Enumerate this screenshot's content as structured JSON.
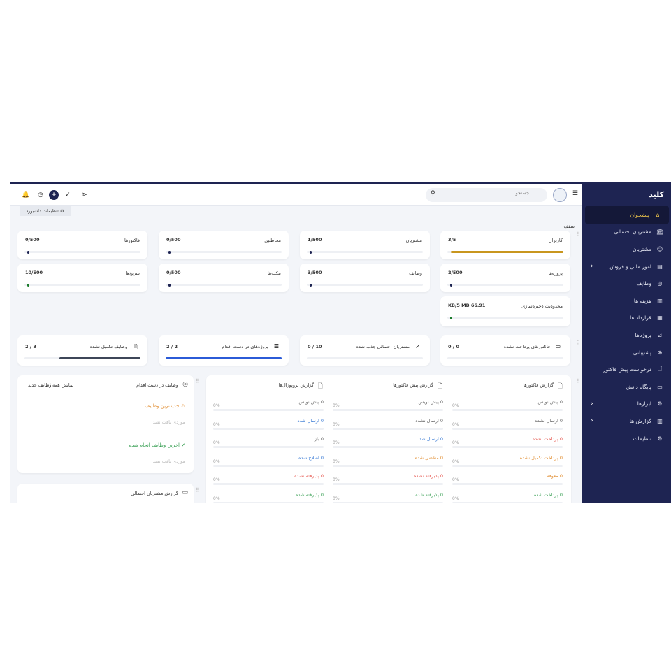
{
  "brand": "کلید",
  "sidebar": {
    "items": [
      {
        "label": "پیشخوان",
        "icon": "home-icon"
      },
      {
        "label": "مشتریان احتمالی",
        "icon": "bank-icon"
      },
      {
        "label": "مشتریان",
        "icon": "user-icon"
      },
      {
        "label": "امور مالی و فروش",
        "icon": "document-icon"
      },
      {
        "label": "وظایف",
        "icon": "check-circle-icon"
      },
      {
        "label": "هزینه ها",
        "icon": "receipt-icon"
      },
      {
        "label": "قرارداد ها",
        "icon": "contract-icon"
      },
      {
        "label": "پروژه‌ها",
        "icon": "chart-icon"
      },
      {
        "label": "پشتیبانی",
        "icon": "support-icon"
      },
      {
        "label": "درخواست پیش فاکتور",
        "icon": "file-icon"
      },
      {
        "label": "پایگاه دانش",
        "icon": "folder-icon"
      },
      {
        "label": "ابزارها",
        "icon": "tools-icon"
      },
      {
        "label": "گزارش ها",
        "icon": "report-icon"
      },
      {
        "label": "تنظیمات",
        "icon": "gear-icon"
      }
    ]
  },
  "topbar": {
    "search_placeholder": "جستجو..."
  },
  "dashboard_settings": "تنظیمات داشبورد",
  "quota_label": "سقف",
  "quota_cards": [
    {
      "title": "کاربران",
      "value": "3/5",
      "color": "#c8961e"
    },
    {
      "title": "مشتریان",
      "value": "1/500",
      "color": "#1e2452"
    },
    {
      "title": "مخاطبین",
      "value": "0/500",
      "color": "#1e2452"
    },
    {
      "title": "فاکتورها",
      "value": "0/500",
      "color": "#1e2452"
    },
    {
      "title": "پروژه‌ها",
      "value": "2/500",
      "color": "#1e2452"
    },
    {
      "title": "وظایف",
      "value": "3/500",
      "color": "#1e2452"
    },
    {
      "title": "تیکت‌ها",
      "value": "0/500",
      "color": "#1e2452"
    },
    {
      "title": "سرنخ‌ها",
      "value": "10/500",
      "color": "#1a7a2a"
    },
    {
      "title": "محدودیت ذخیره‌سازی",
      "value": "66.91 KB/5 MB",
      "color": "#1a7a2a"
    }
  ],
  "big_cards": [
    {
      "title": "فاکتورهای پرداخت نشده",
      "value": "0 / 0",
      "color": "#1e2452"
    },
    {
      "title": "مشتریان احتمالی جذب شده",
      "value": "10 / 0",
      "color": "#1e2452"
    },
    {
      "title": "پروژه‌های در دست اقدام",
      "value": "2 / 2",
      "color": "#2b5bd7"
    },
    {
      "title": "وظایف تکمیل نشده",
      "value": "3 / 2",
      "color": "#3d4658"
    }
  ],
  "reports": {
    "invoices": {
      "title": "گزارش فاکتورها",
      "rows": [
        {
          "label": "0 پیش نویس",
          "pct": "0%",
          "cls": "gray"
        },
        {
          "label": "0 ارسال نشده",
          "pct": "0%",
          "cls": "gray"
        },
        {
          "label": "0 پرداخت نشده",
          "pct": "0%",
          "cls": "red"
        },
        {
          "label": "0 پرداخت تکمیل نشده",
          "pct": "0%",
          "cls": "orange"
        },
        {
          "label": "0 معوقه",
          "pct": "0%",
          "cls": "orange"
        },
        {
          "label": "0 پرداخت شده",
          "pct": "0%",
          "cls": "green"
        }
      ]
    },
    "estimates": {
      "title": "گزارش پیش فاکتورها",
      "rows": [
        {
          "label": "0 پیش نویس",
          "pct": "0%",
          "cls": "gray"
        },
        {
          "label": "0 ارسال نشده",
          "pct": "0%",
          "cls": "gray"
        },
        {
          "label": "0 ارسال شد",
          "pct": "0%",
          "cls": "blue"
        },
        {
          "label": "0 منقضی شده",
          "pct": "0%",
          "cls": "orange"
        },
        {
          "label": "0 پذیرفته نشده",
          "pct": "0%",
          "cls": "red"
        },
        {
          "label": "0 پذیرفته شده",
          "pct": "0%",
          "cls": "green"
        }
      ]
    },
    "proposals": {
      "title": "گزارش پروپوزال‌ها",
      "rows": [
        {
          "label": "0 پیش نویس",
          "pct": "0%",
          "cls": "gray"
        },
        {
          "label": "0 ارسال شده",
          "pct": "0%",
          "cls": "blue"
        },
        {
          "label": "0 باز",
          "pct": "0%",
          "cls": "gray"
        },
        {
          "label": "0 اصلاح شده",
          "pct": "0%",
          "cls": "blue"
        },
        {
          "label": "0 پذیرفته نشده",
          "pct": "0%",
          "cls": "red"
        },
        {
          "label": "0 پذیرفته شده",
          "pct": "0%",
          "cls": "green"
        }
      ]
    }
  },
  "tasks_panel": {
    "title": "وظایف در دست اقدام",
    "show_all": "نمایش همه",
    "new_task": "وظایف جدید",
    "latest_tasks": "جدیدترین وظایف",
    "empty": "موردی یافت نشد",
    "latest_done": "اخرین وظایف انجام شده",
    "empty2": "موردی یافت نشد"
  },
  "leads_report": {
    "title": "گزارش مشتریان احتمالی"
  }
}
